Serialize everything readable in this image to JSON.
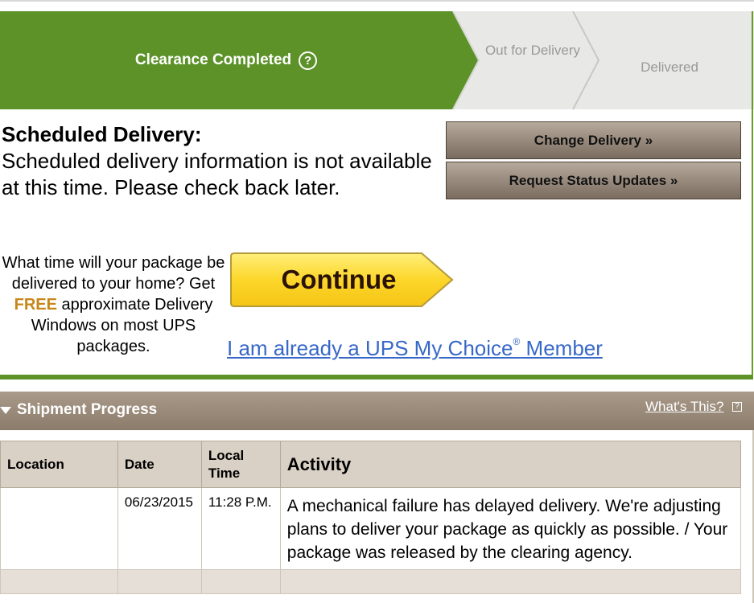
{
  "progress": {
    "current_step": "Clearance Completed",
    "next_step": "Out for Delivery",
    "last_step": "Delivered",
    "help_icon": "question-circle-icon",
    "colors": {
      "active": "#5c9228",
      "inactive": "#e8e8e6"
    }
  },
  "scheduled": {
    "title": "Scheduled Delivery:",
    "body": "Scheduled delivery information is not available at this time. Please check back later."
  },
  "buttons": {
    "change_delivery": "Change Delivery »",
    "request_updates": "Request Status Updates »"
  },
  "promo": {
    "line_a": "What time will your package be delivered to your home?",
    "get": "Get",
    "free": "FREE",
    "line_b": "approximate Delivery Windows on most UPS packages.",
    "continue_label": "Continue",
    "member_link_pre": "I am already a UPS My Choice",
    "member_link_reg": "®",
    "member_link_post": " Member"
  },
  "shipment_progress": {
    "title": "Shipment Progress",
    "whats_this": "What's This?",
    "columns": [
      "Location",
      "Date",
      "Local Time",
      "Activity"
    ],
    "rows": [
      {
        "location": "",
        "date": "06/23/2015",
        "time": "11:28 P.M.",
        "activity": "A mechanical failure has delayed delivery. We're adjusting plans to deliver your package as quickly as possible. / Your package was released by the clearing agency."
      }
    ]
  }
}
